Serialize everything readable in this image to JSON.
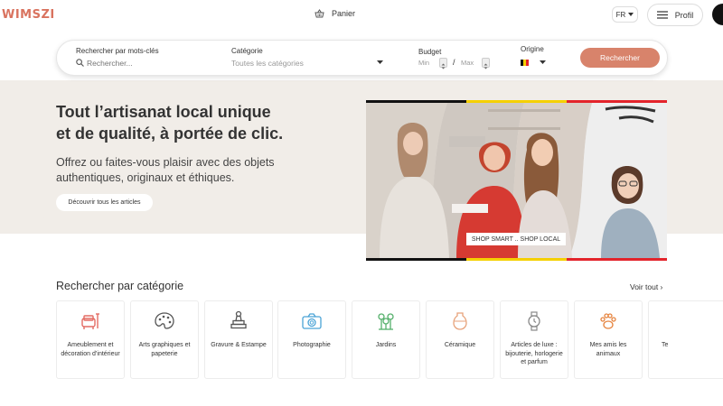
{
  "header": {
    "logo": "WIMSZI",
    "cart_label": "Panier",
    "lang_label": "FR",
    "profile_label": "Profil"
  },
  "search": {
    "keywords_label": "Rechercher par mots-clés",
    "keywords_placeholder": "Rechercher...",
    "category_label": "Catégorie",
    "category_value": "Toutes les catégories",
    "budget_label": "Budget",
    "budget_min": "Min",
    "budget_separator": "/",
    "budget_max": "Max",
    "origin_label": "Origine",
    "button_label": "Rechercher"
  },
  "hero": {
    "headline_line1": "Tout l’artisanat local unique",
    "headline_line2": "et de qualité, à portée de clic.",
    "subline_line1": "Offrez ou faites-vous plaisir avec des objets",
    "subline_line2": "authentiques, originaux et éthiques.",
    "cta_label": "Découvrir tous les articles",
    "photo_badge": "SHOP SMART .. SHOP LOCAL"
  },
  "categories": {
    "title": "Rechercher par catégorie",
    "see_all": "Voir tout ›",
    "items": [
      {
        "label": "Ameublement et décoration d’intérieur",
        "icon": "furniture-icon",
        "color": "#e36b63"
      },
      {
        "label": "Arts graphiques et papeterie",
        "icon": "palette-icon",
        "color": "#555555"
      },
      {
        "label": "Gravure & Estampe",
        "icon": "stamp-icon",
        "color": "#555555"
      },
      {
        "label": "Photographie",
        "icon": "camera-icon",
        "color": "#4aa3d6"
      },
      {
        "label": "Jardins",
        "icon": "flowers-icon",
        "color": "#55b06b"
      },
      {
        "label": "Céramique",
        "icon": "vase-icon",
        "color": "#e7a27a"
      },
      {
        "label": "Articles de luxe : bijouterie, horlogerie et parfum",
        "icon": "watch-icon",
        "color": "#888888"
      },
      {
        "label": "Mes amis les animaux",
        "icon": "paw-icon",
        "color": "#e6843f"
      },
      {
        "label": "Te",
        "icon": "",
        "color": "#555555"
      }
    ]
  },
  "colors": {
    "brand": "#d9735f",
    "button": "#d8836b",
    "hero_bg": "#f1ede8"
  }
}
